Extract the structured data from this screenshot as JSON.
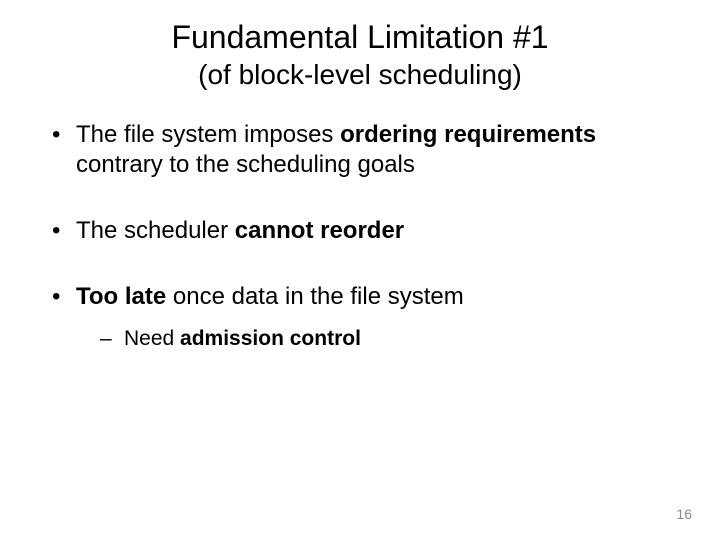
{
  "title": "Fundamental Limitation #1",
  "subtitle": "(of block-level scheduling)",
  "bullets": {
    "b1_pre": "The file system imposes ",
    "b1_bold": "ordering requirements",
    "b1_post": " contrary to the scheduling goals",
    "b2_pre": "The scheduler ",
    "b2_bold": "cannot reorder",
    "b3_bold": "Too late",
    "b3_post": " once data in the file system",
    "b3_sub_pre": "Need ",
    "b3_sub_bold": "admission control"
  },
  "page_number": "16"
}
